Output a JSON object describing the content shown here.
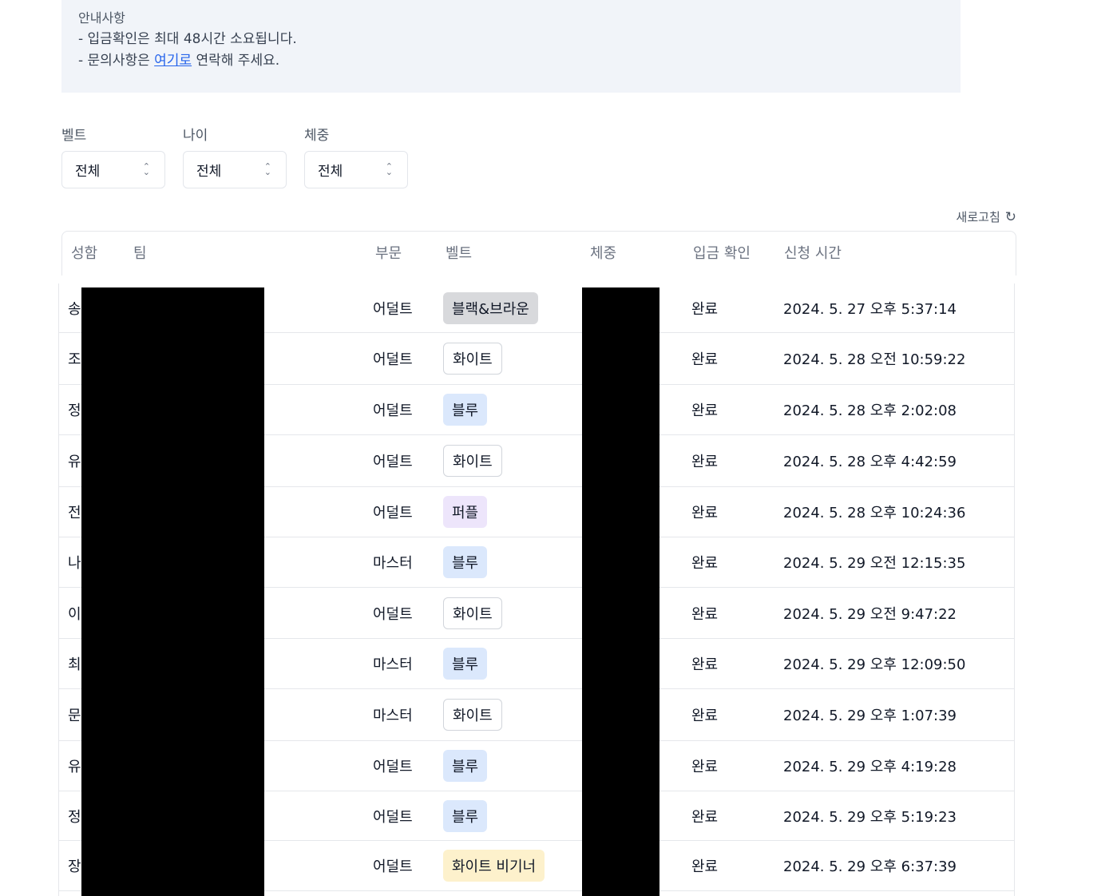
{
  "notice": {
    "title": "안내사항",
    "line1": "- 입금확인은 최대 48시간 소요됩니다.",
    "line2_prefix": "- 문의사항은 ",
    "line2_link": "여기로",
    "line2_suffix": " 연락해 주세요."
  },
  "filters": [
    {
      "label": "벨트",
      "value": "전체"
    },
    {
      "label": "나이",
      "value": "전체"
    },
    {
      "label": "체중",
      "value": "전체"
    }
  ],
  "refresh_label": "새로고침",
  "table": {
    "headers": {
      "name": "성함",
      "team": "팀",
      "division": "부문",
      "belt": "벨트",
      "weight": "체중",
      "payment": "입금 확인",
      "time": "신청 시간"
    },
    "rows": [
      {
        "name": "송",
        "division": "어덜트",
        "belt": "블랙&브라운",
        "belt_style": "bb",
        "payment": "완료",
        "time": "2024. 5. 27 오후 5:37:14"
      },
      {
        "name": "조",
        "division": "어덜트",
        "belt": "화이트",
        "belt_style": "white",
        "payment": "완료",
        "time": "2024. 5. 28 오전 10:59:22"
      },
      {
        "name": "정",
        "division": "어덜트",
        "belt": "블루",
        "belt_style": "blue",
        "payment": "완료",
        "time": "2024. 5. 28 오후 2:02:08"
      },
      {
        "name": "유",
        "division": "어덜트",
        "belt": "화이트",
        "belt_style": "white",
        "payment": "완료",
        "time": "2024. 5. 28 오후 4:42:59"
      },
      {
        "name": "전",
        "division": "어덜트",
        "belt": "퍼플",
        "belt_style": "purple",
        "payment": "완료",
        "time": "2024. 5. 28 오후 10:24:36"
      },
      {
        "name": "나",
        "division": "마스터",
        "belt": "블루",
        "belt_style": "blue",
        "payment": "완료",
        "time": "2024. 5. 29 오전 12:15:35"
      },
      {
        "name": "이",
        "division": "어덜트",
        "belt": "화이트",
        "belt_style": "white",
        "payment": "완료",
        "time": "2024. 5. 29 오전 9:47:22"
      },
      {
        "name": "최",
        "division": "마스터",
        "belt": "블루",
        "belt_style": "blue",
        "payment": "완료",
        "time": "2024. 5. 29 오후 12:09:50"
      },
      {
        "name": "문",
        "division": "마스터",
        "belt": "화이트",
        "belt_style": "white",
        "payment": "완료",
        "time": "2024. 5. 29 오후 1:07:39"
      },
      {
        "name": "유",
        "division": "어덜트",
        "belt": "블루",
        "belt_style": "blue",
        "payment": "완료",
        "time": "2024. 5. 29 오후 4:19:28"
      },
      {
        "name": "정",
        "division": "어덜트",
        "belt": "블루",
        "belt_style": "blue",
        "payment": "완료",
        "time": "2024. 5. 29 오후 5:19:23"
      },
      {
        "name": "장",
        "division": "어덜트",
        "belt": "화이트 비기너",
        "belt_style": "wb",
        "payment": "완료",
        "time": "2024. 5. 29 오후 6:37:39"
      }
    ]
  }
}
